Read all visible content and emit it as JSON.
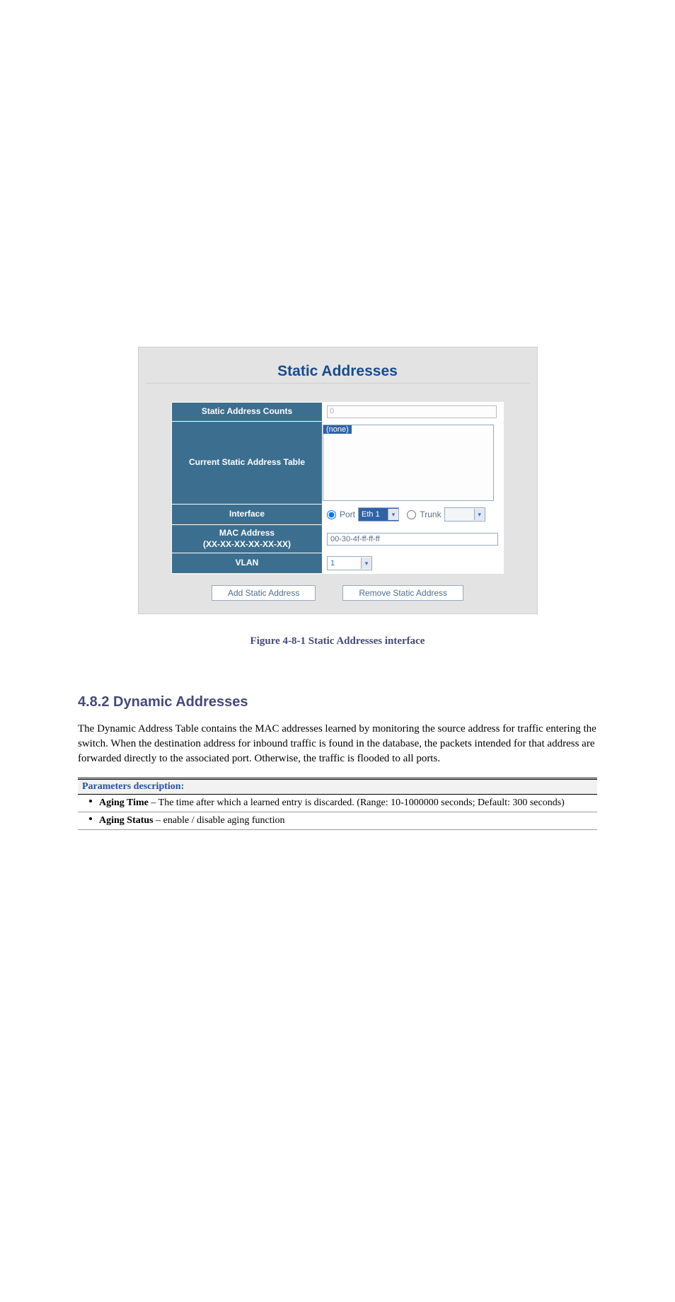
{
  "panel": {
    "title": "Static Addresses",
    "rows": {
      "counts_label": "Static Address Counts",
      "counts_value": "0",
      "table_label": "Current Static Address Table",
      "table_selected": "(none)",
      "interface_label": "Interface",
      "port_label": "Port",
      "port_value": "Eth 1",
      "trunk_label": "Trunk",
      "mac_label_line1": "MAC Address",
      "mac_label_line2": "(XX-XX-XX-XX-XX-XX)",
      "mac_value": "00-30-4f-ff-ff-ff",
      "vlan_label": "VLAN",
      "vlan_value": "1"
    },
    "buttons": {
      "add": "Add Static Address",
      "remove": "Remove Static Address"
    }
  },
  "caption": "Figure 4-8-1 Static Addresses interface",
  "section": {
    "title": "4.8.2 Dynamic Addresses",
    "body": "The Dynamic Address Table contains the MAC addresses learned by monitoring the source address for traffic entering the switch. When the destination address for inbound traffic is found in the database, the packets intended for that address are forwarded directly to the associated port. Otherwise, the traffic is flooded to all ports.",
    "params_header": "Parameters description:",
    "params": [
      {
        "name": "Aging Time",
        "desc": "The time after which a learned entry is discarded. (Range: 10-1000000 seconds; Default: 300 seconds)"
      },
      {
        "name": "Aging Status",
        "desc": "enable / disable aging function"
      }
    ]
  }
}
